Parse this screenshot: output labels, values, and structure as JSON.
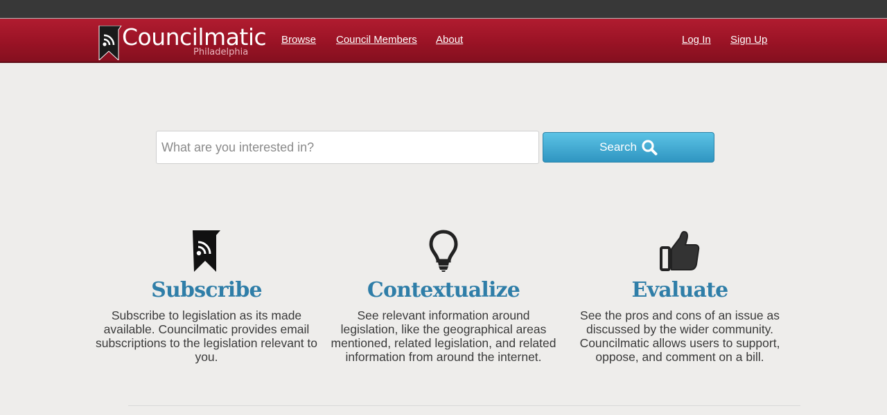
{
  "header": {
    "logo_title": "Councilmatic",
    "logo_subtitle": "Philadelphia",
    "nav": {
      "browse": "Browse",
      "council_members": "Council Members",
      "about": "About",
      "login": "Log In",
      "signup": "Sign Up"
    }
  },
  "search": {
    "placeholder": "What are you interested in?",
    "button_label": "Search"
  },
  "features": [
    {
      "icon": "bookmark-rss-icon",
      "title": "Subscribe",
      "text": "Subscribe to legislation as its made available. Councilmatic provides email subscriptions to the legislation relevant to you."
    },
    {
      "icon": "lightbulb-icon",
      "title": "Contextualize",
      "text": "See relevant information around legislation, like the geographical areas mentioned, related legislation, and related information from around the internet."
    },
    {
      "icon": "thumbs-up-icon",
      "title": "Evaluate",
      "text": "See the pros and cons of an issue as discussed by the wider community. Councilmatic allows users to support, oppose, and comment on a bill."
    }
  ],
  "colors": {
    "navbar": "#9a1325",
    "topbar": "#383838",
    "accent": "#2f7ea8",
    "search_button": "#3aa6d0"
  }
}
